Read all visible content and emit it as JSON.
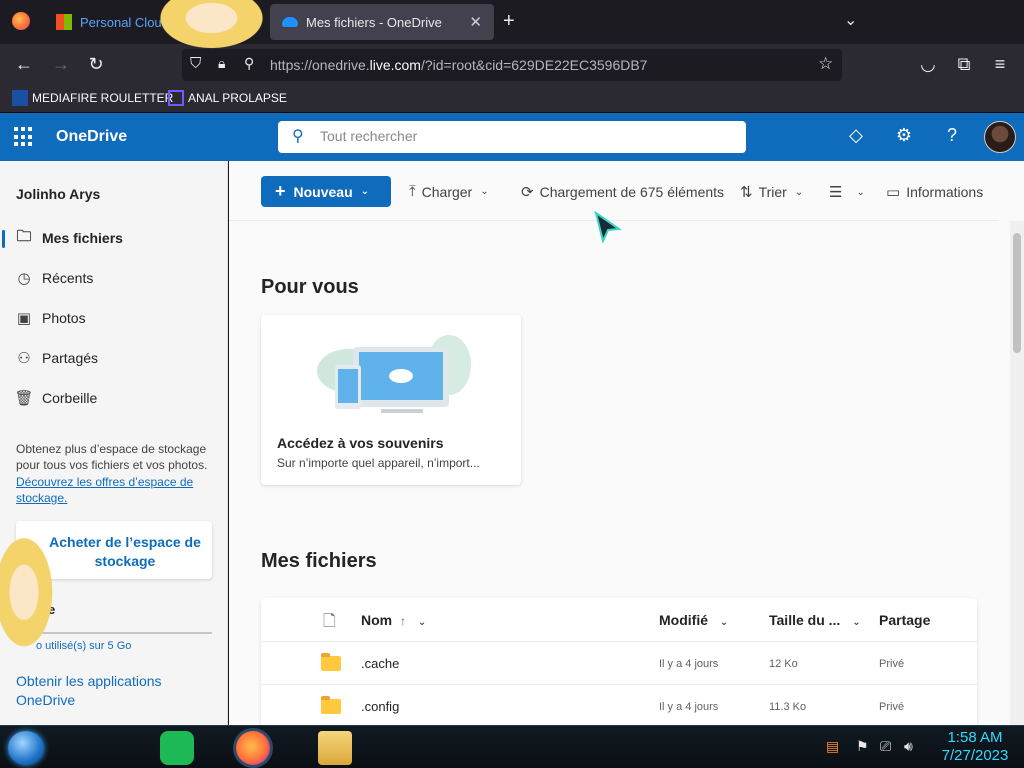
{
  "browser": {
    "tabs": [
      {
        "title": "Personal Clou",
        "active": false
      },
      {
        "title": "Mes fichiers - OneDrive",
        "active": true
      }
    ],
    "url_prefix": "https://onedrive.",
    "url_domain": "live.com",
    "url_suffix": "/?id=root&cid=629DE22EC3596DB7",
    "bookmarks": [
      "MEDIAFIRE ROULETTER",
      "ANAL PROLAPSE"
    ]
  },
  "header": {
    "app_name": "OneDrive",
    "search_placeholder": "Tout rechercher"
  },
  "sidebar": {
    "user_name": "Jolinho Arys",
    "items": [
      {
        "label": "Mes fichiers",
        "icon": "folder-icon",
        "active": true
      },
      {
        "label": "Récents",
        "icon": "clock-icon",
        "active": false
      },
      {
        "label": "Photos",
        "icon": "photo-icon",
        "active": false
      },
      {
        "label": "Partagés",
        "icon": "people-icon",
        "active": false
      },
      {
        "label": "Corbeille",
        "icon": "trash-icon",
        "active": false
      }
    ],
    "storage_promo": "Obtenez plus d’espace de stockage pour tous vos fichiers et vos photos.",
    "storage_link": "Découvrez les offres d’espace de stockage.",
    "buy_button": "Acheter de l’espace de stockage",
    "storage_label": "ge",
    "storage_used": "o utilisé(s) sur 5 Go",
    "get_apps": "Obtenir les applications OneDrive"
  },
  "toolbar": {
    "new_label": "Nouveau",
    "upload_label": "Charger",
    "loading_label": "Chargement de 675 éléments",
    "sort_label": "Trier",
    "info_label": "Informations"
  },
  "for_you": {
    "title": "Pour vous",
    "card_title": "Accédez à vos souvenirs",
    "card_subtitle": "Sur n’importe quel appareil, n’import..."
  },
  "my_files": {
    "title": "Mes fichiers",
    "columns": {
      "name": "Nom",
      "sort_arrow": "↑",
      "modified": "Modifié",
      "size": "Taille du ...",
      "sharing": "Partage"
    },
    "rows": [
      {
        "name": ".cache",
        "modified": "Il y a 4 jours",
        "size": "12 Ko",
        "sharing": "Privé"
      },
      {
        "name": ".config",
        "modified": "Il y a 4 jours",
        "size": "11.3 Ko",
        "sharing": "Privé"
      }
    ]
  },
  "taskbar": {
    "time": "1:58 AM",
    "date": "7/27/2023"
  },
  "colors": {
    "onedrive_blue": "#0f6cbd",
    "browser_dark": "#1c1b22",
    "toolbar_dark": "#2b2a33",
    "clock_cyan": "#32d9ff"
  }
}
